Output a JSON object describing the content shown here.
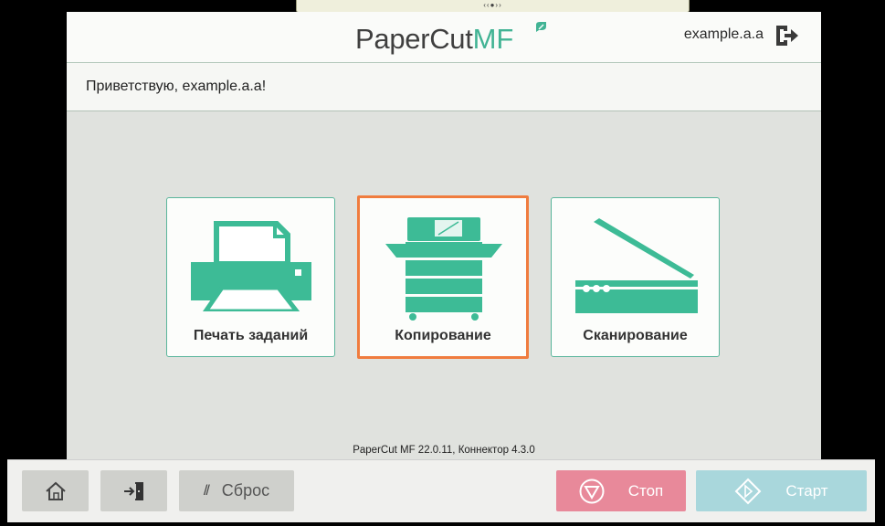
{
  "header": {
    "logo_text": "PaperCut",
    "logo_mf": "MF",
    "user": "example.a.a"
  },
  "welcome": "Приветствую, example.a.a!",
  "tiles": [
    {
      "label": "Печать заданий",
      "icon": "printer-icon"
    },
    {
      "label": "Копирование",
      "icon": "copier-icon",
      "selected": true
    },
    {
      "label": "Сканирование",
      "icon": "scanner-icon"
    }
  ],
  "footer": {
    "version": "PaperCut MF 22.0.11, Коннектор 4.3.0"
  },
  "controls": {
    "reset_label": "Сброс",
    "stop_label": "Стоп",
    "start_label": "Старт"
  },
  "colors": {
    "accent": "#41b394",
    "selection": "#f07c3e",
    "stop": "#e8899a",
    "start": "#a9d7dc"
  }
}
